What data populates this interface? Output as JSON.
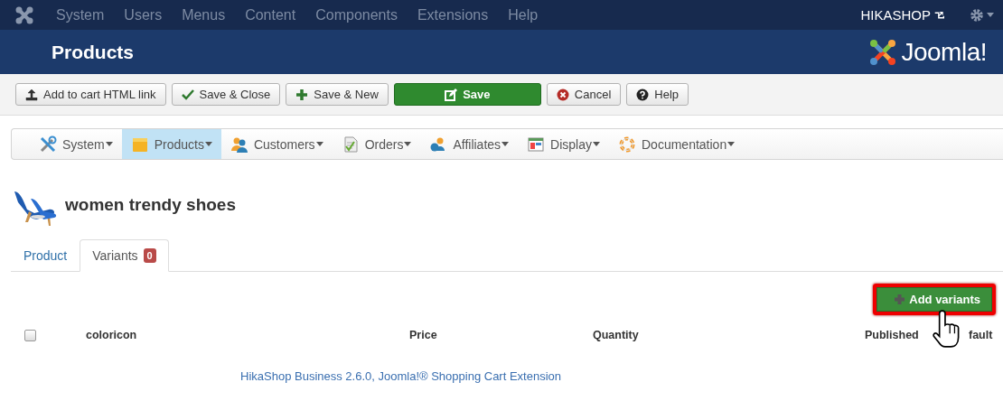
{
  "top_menu": {
    "items": [
      "System",
      "Users",
      "Menus",
      "Content",
      "Components",
      "Extensions",
      "Help"
    ],
    "site_link": "HIKASHOP"
  },
  "header": {
    "title": "Products",
    "logo_text": "Joomla!"
  },
  "toolbar": [
    {
      "label": "Add to cart HTML link",
      "kind": "upload"
    },
    {
      "label": "Save & Close",
      "kind": "check"
    },
    {
      "label": "Save & New",
      "kind": "plus"
    },
    {
      "label": "Save",
      "kind": "primary"
    },
    {
      "label": "Cancel",
      "kind": "cancel"
    },
    {
      "label": "Help",
      "kind": "help"
    }
  ],
  "submenu": [
    {
      "label": "System",
      "kind": "tools",
      "selected": false
    },
    {
      "label": "Products",
      "kind": "box",
      "selected": true
    },
    {
      "label": "Customers",
      "kind": "users",
      "selected": false
    },
    {
      "label": "Orders",
      "kind": "doc",
      "selected": false
    },
    {
      "label": "Affiliates",
      "kind": "affiliate",
      "selected": false
    },
    {
      "label": "Display",
      "kind": "display",
      "selected": false
    },
    {
      "label": "Documentation",
      "kind": "lifebuoy",
      "selected": false
    }
  ],
  "product": {
    "title": "women trendy shoes"
  },
  "tabs": [
    {
      "label": "Product",
      "selected": false
    },
    {
      "label": "Variants",
      "badge": "0",
      "selected": true
    }
  ],
  "add_button": {
    "label": "Add variants",
    "highlighted": true
  },
  "table": {
    "select_all": {
      "checked": false
    },
    "columns": [
      "coloricon",
      "Price",
      "Quantity",
      "Published",
      "fault"
    ]
  },
  "footer": {
    "link": "HikaShop Business 2.6.0, Joomla!® Shopping Cart Extension"
  }
}
